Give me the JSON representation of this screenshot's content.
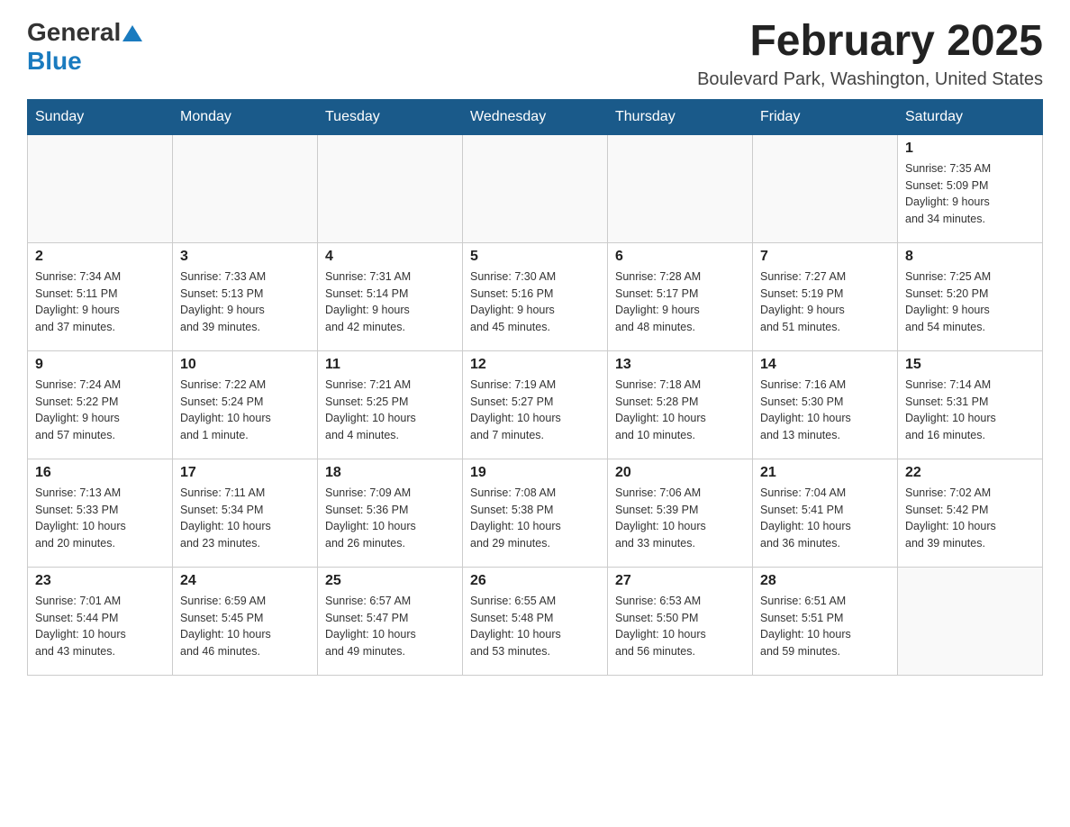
{
  "header": {
    "logo_general": "General",
    "logo_blue": "Blue",
    "main_title": "February 2025",
    "subtitle": "Boulevard Park, Washington, United States"
  },
  "days_of_week": [
    "Sunday",
    "Monday",
    "Tuesday",
    "Wednesday",
    "Thursday",
    "Friday",
    "Saturday"
  ],
  "weeks": [
    [
      {
        "day": "",
        "info": ""
      },
      {
        "day": "",
        "info": ""
      },
      {
        "day": "",
        "info": ""
      },
      {
        "day": "",
        "info": ""
      },
      {
        "day": "",
        "info": ""
      },
      {
        "day": "",
        "info": ""
      },
      {
        "day": "1",
        "info": "Sunrise: 7:35 AM\nSunset: 5:09 PM\nDaylight: 9 hours\nand 34 minutes."
      }
    ],
    [
      {
        "day": "2",
        "info": "Sunrise: 7:34 AM\nSunset: 5:11 PM\nDaylight: 9 hours\nand 37 minutes."
      },
      {
        "day": "3",
        "info": "Sunrise: 7:33 AM\nSunset: 5:13 PM\nDaylight: 9 hours\nand 39 minutes."
      },
      {
        "day": "4",
        "info": "Sunrise: 7:31 AM\nSunset: 5:14 PM\nDaylight: 9 hours\nand 42 minutes."
      },
      {
        "day": "5",
        "info": "Sunrise: 7:30 AM\nSunset: 5:16 PM\nDaylight: 9 hours\nand 45 minutes."
      },
      {
        "day": "6",
        "info": "Sunrise: 7:28 AM\nSunset: 5:17 PM\nDaylight: 9 hours\nand 48 minutes."
      },
      {
        "day": "7",
        "info": "Sunrise: 7:27 AM\nSunset: 5:19 PM\nDaylight: 9 hours\nand 51 minutes."
      },
      {
        "day": "8",
        "info": "Sunrise: 7:25 AM\nSunset: 5:20 PM\nDaylight: 9 hours\nand 54 minutes."
      }
    ],
    [
      {
        "day": "9",
        "info": "Sunrise: 7:24 AM\nSunset: 5:22 PM\nDaylight: 9 hours\nand 57 minutes."
      },
      {
        "day": "10",
        "info": "Sunrise: 7:22 AM\nSunset: 5:24 PM\nDaylight: 10 hours\nand 1 minute."
      },
      {
        "day": "11",
        "info": "Sunrise: 7:21 AM\nSunset: 5:25 PM\nDaylight: 10 hours\nand 4 minutes."
      },
      {
        "day": "12",
        "info": "Sunrise: 7:19 AM\nSunset: 5:27 PM\nDaylight: 10 hours\nand 7 minutes."
      },
      {
        "day": "13",
        "info": "Sunrise: 7:18 AM\nSunset: 5:28 PM\nDaylight: 10 hours\nand 10 minutes."
      },
      {
        "day": "14",
        "info": "Sunrise: 7:16 AM\nSunset: 5:30 PM\nDaylight: 10 hours\nand 13 minutes."
      },
      {
        "day": "15",
        "info": "Sunrise: 7:14 AM\nSunset: 5:31 PM\nDaylight: 10 hours\nand 16 minutes."
      }
    ],
    [
      {
        "day": "16",
        "info": "Sunrise: 7:13 AM\nSunset: 5:33 PM\nDaylight: 10 hours\nand 20 minutes."
      },
      {
        "day": "17",
        "info": "Sunrise: 7:11 AM\nSunset: 5:34 PM\nDaylight: 10 hours\nand 23 minutes."
      },
      {
        "day": "18",
        "info": "Sunrise: 7:09 AM\nSunset: 5:36 PM\nDaylight: 10 hours\nand 26 minutes."
      },
      {
        "day": "19",
        "info": "Sunrise: 7:08 AM\nSunset: 5:38 PM\nDaylight: 10 hours\nand 29 minutes."
      },
      {
        "day": "20",
        "info": "Sunrise: 7:06 AM\nSunset: 5:39 PM\nDaylight: 10 hours\nand 33 minutes."
      },
      {
        "day": "21",
        "info": "Sunrise: 7:04 AM\nSunset: 5:41 PM\nDaylight: 10 hours\nand 36 minutes."
      },
      {
        "day": "22",
        "info": "Sunrise: 7:02 AM\nSunset: 5:42 PM\nDaylight: 10 hours\nand 39 minutes."
      }
    ],
    [
      {
        "day": "23",
        "info": "Sunrise: 7:01 AM\nSunset: 5:44 PM\nDaylight: 10 hours\nand 43 minutes."
      },
      {
        "day": "24",
        "info": "Sunrise: 6:59 AM\nSunset: 5:45 PM\nDaylight: 10 hours\nand 46 minutes."
      },
      {
        "day": "25",
        "info": "Sunrise: 6:57 AM\nSunset: 5:47 PM\nDaylight: 10 hours\nand 49 minutes."
      },
      {
        "day": "26",
        "info": "Sunrise: 6:55 AM\nSunset: 5:48 PM\nDaylight: 10 hours\nand 53 minutes."
      },
      {
        "day": "27",
        "info": "Sunrise: 6:53 AM\nSunset: 5:50 PM\nDaylight: 10 hours\nand 56 minutes."
      },
      {
        "day": "28",
        "info": "Sunrise: 6:51 AM\nSunset: 5:51 PM\nDaylight: 10 hours\nand 59 minutes."
      },
      {
        "day": "",
        "info": ""
      }
    ]
  ]
}
